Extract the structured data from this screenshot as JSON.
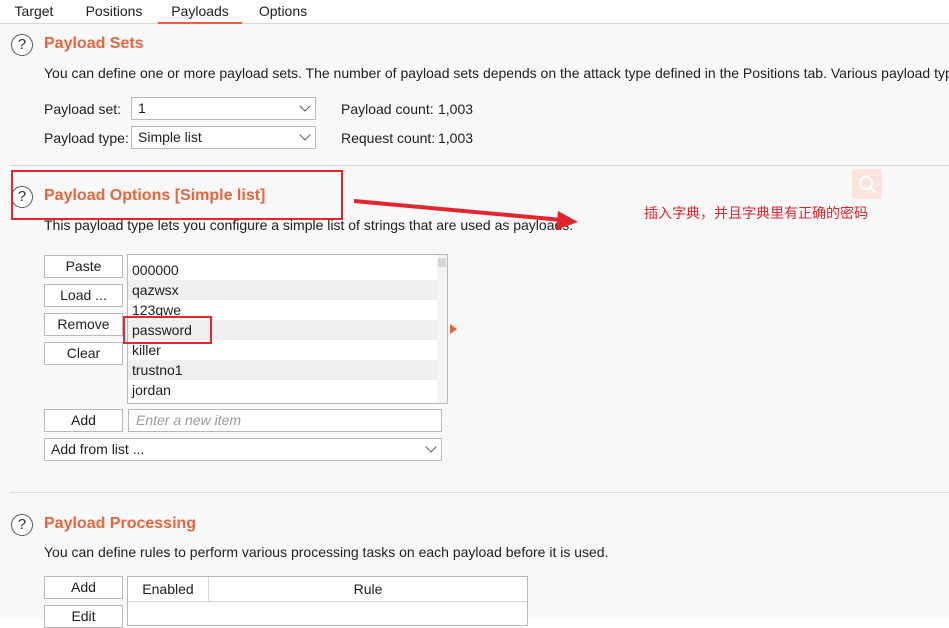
{
  "tabs": [
    {
      "label": "Target"
    },
    {
      "label": "Positions"
    },
    {
      "label": "Payloads"
    },
    {
      "label": "Options"
    }
  ],
  "payload_sets": {
    "title": "Payload Sets",
    "description": "You can define one or more payload sets. The number of payload sets depends on the attack type defined in the Positions tab. Various payload typ",
    "set_label": "Payload set:",
    "set_value": "1",
    "type_label": "Payload type:",
    "type_value": "Simple list",
    "payload_count_label": "Payload count:",
    "payload_count": "1,003",
    "request_count_label": "Request count:",
    "request_count": "1,003"
  },
  "payload_options": {
    "title": "Payload Options [Simple list]",
    "description": "This payload type lets you configure a simple list of strings that are used as payloads.",
    "buttons": {
      "paste": "Paste",
      "load": "Load ...",
      "remove": "Remove",
      "clear": "Clear",
      "add": "Add"
    },
    "items": [
      "000000",
      "qazwsx",
      "123qwe",
      "password",
      "killer",
      "trustno1",
      "jordan"
    ],
    "new_item_placeholder": "Enter a new item",
    "add_from_list": "Add from list ..."
  },
  "payload_processing": {
    "title": "Payload Processing",
    "description": "You can define rules to perform various processing tasks on each payload before it is used.",
    "buttons": {
      "add": "Add",
      "edit": "Edit"
    },
    "columns": [
      "Enabled",
      "Rule"
    ]
  },
  "annotation": {
    "text": "插入字典，并且字典里有正确的密码"
  },
  "colors": {
    "accent": "#e8643a",
    "annotation_red": "#e2262b"
  },
  "icons": {
    "help": "question-circle-icon",
    "search": "search-icon",
    "expand": "triangle-right-icon"
  }
}
